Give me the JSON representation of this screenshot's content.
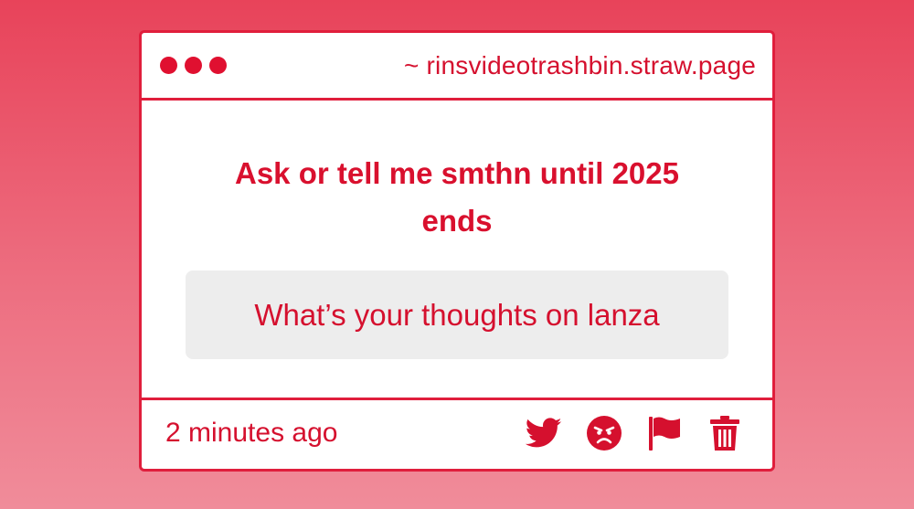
{
  "window": {
    "url": "~ rinsvideotrashbin.straw.page"
  },
  "post": {
    "prompt": "Ask or tell me smthn until 2025 ends",
    "message": "What’s your thoughts on lanza",
    "timestamp": "2 minutes ago"
  },
  "actions": [
    {
      "icon": "twitter-bird-icon"
    },
    {
      "icon": "angry-face-icon"
    },
    {
      "icon": "flag-icon"
    },
    {
      "icon": "trash-icon"
    }
  ],
  "colors": {
    "accent": "#d5102e",
    "background_top": "#e8435a",
    "background_bottom": "#f08c9a",
    "message_bg": "#ededed"
  }
}
